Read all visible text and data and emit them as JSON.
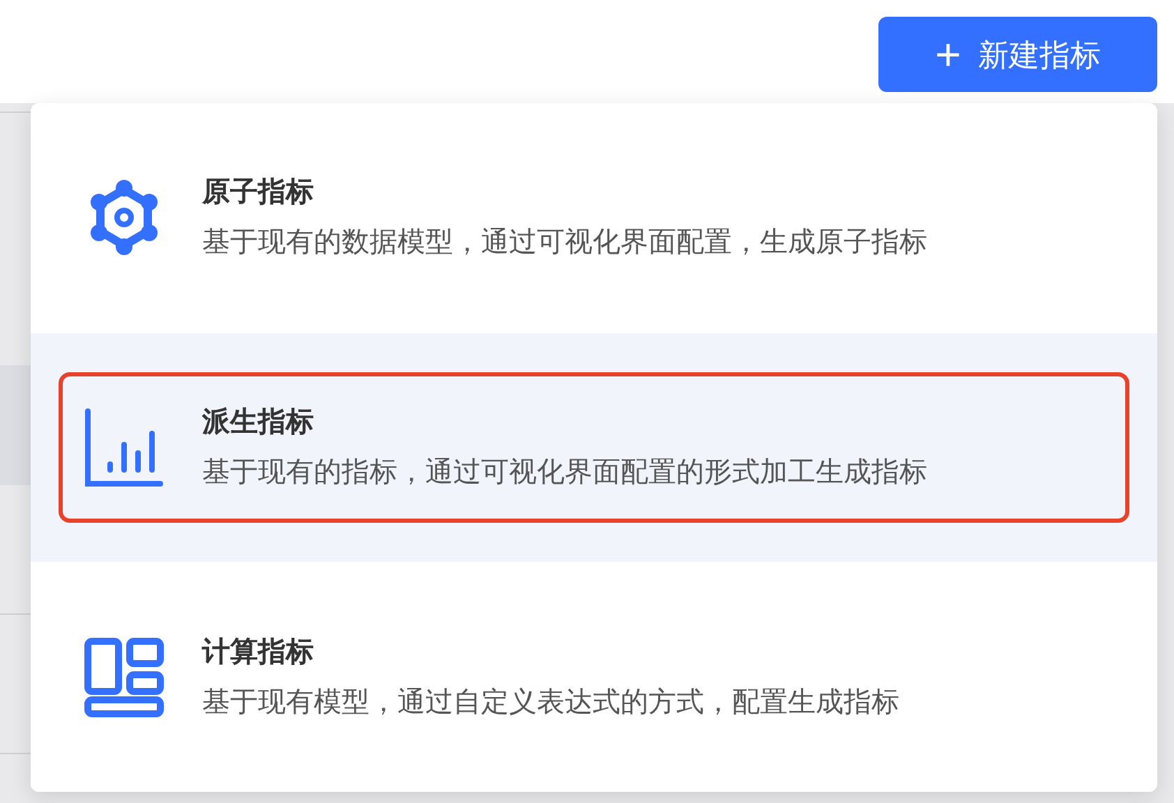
{
  "new_button": {
    "icon": "+",
    "label": "新建指标"
  },
  "menu": {
    "items": [
      {
        "kind": "atomic",
        "title": "原子指标",
        "description": "基于现有的数据模型，通过可视化界面配置，生成原子指标",
        "selected": false,
        "outlined": false
      },
      {
        "kind": "derived",
        "title": "派生指标",
        "description": "基于现有的指标，通过可视化界面配置的形式加工生成指标",
        "selected": true,
        "outlined": true
      },
      {
        "kind": "computed",
        "title": "计算指标",
        "description": "基于现有模型，通过自定义表达式的方式，配置生成指标",
        "selected": false,
        "outlined": false
      }
    ]
  }
}
